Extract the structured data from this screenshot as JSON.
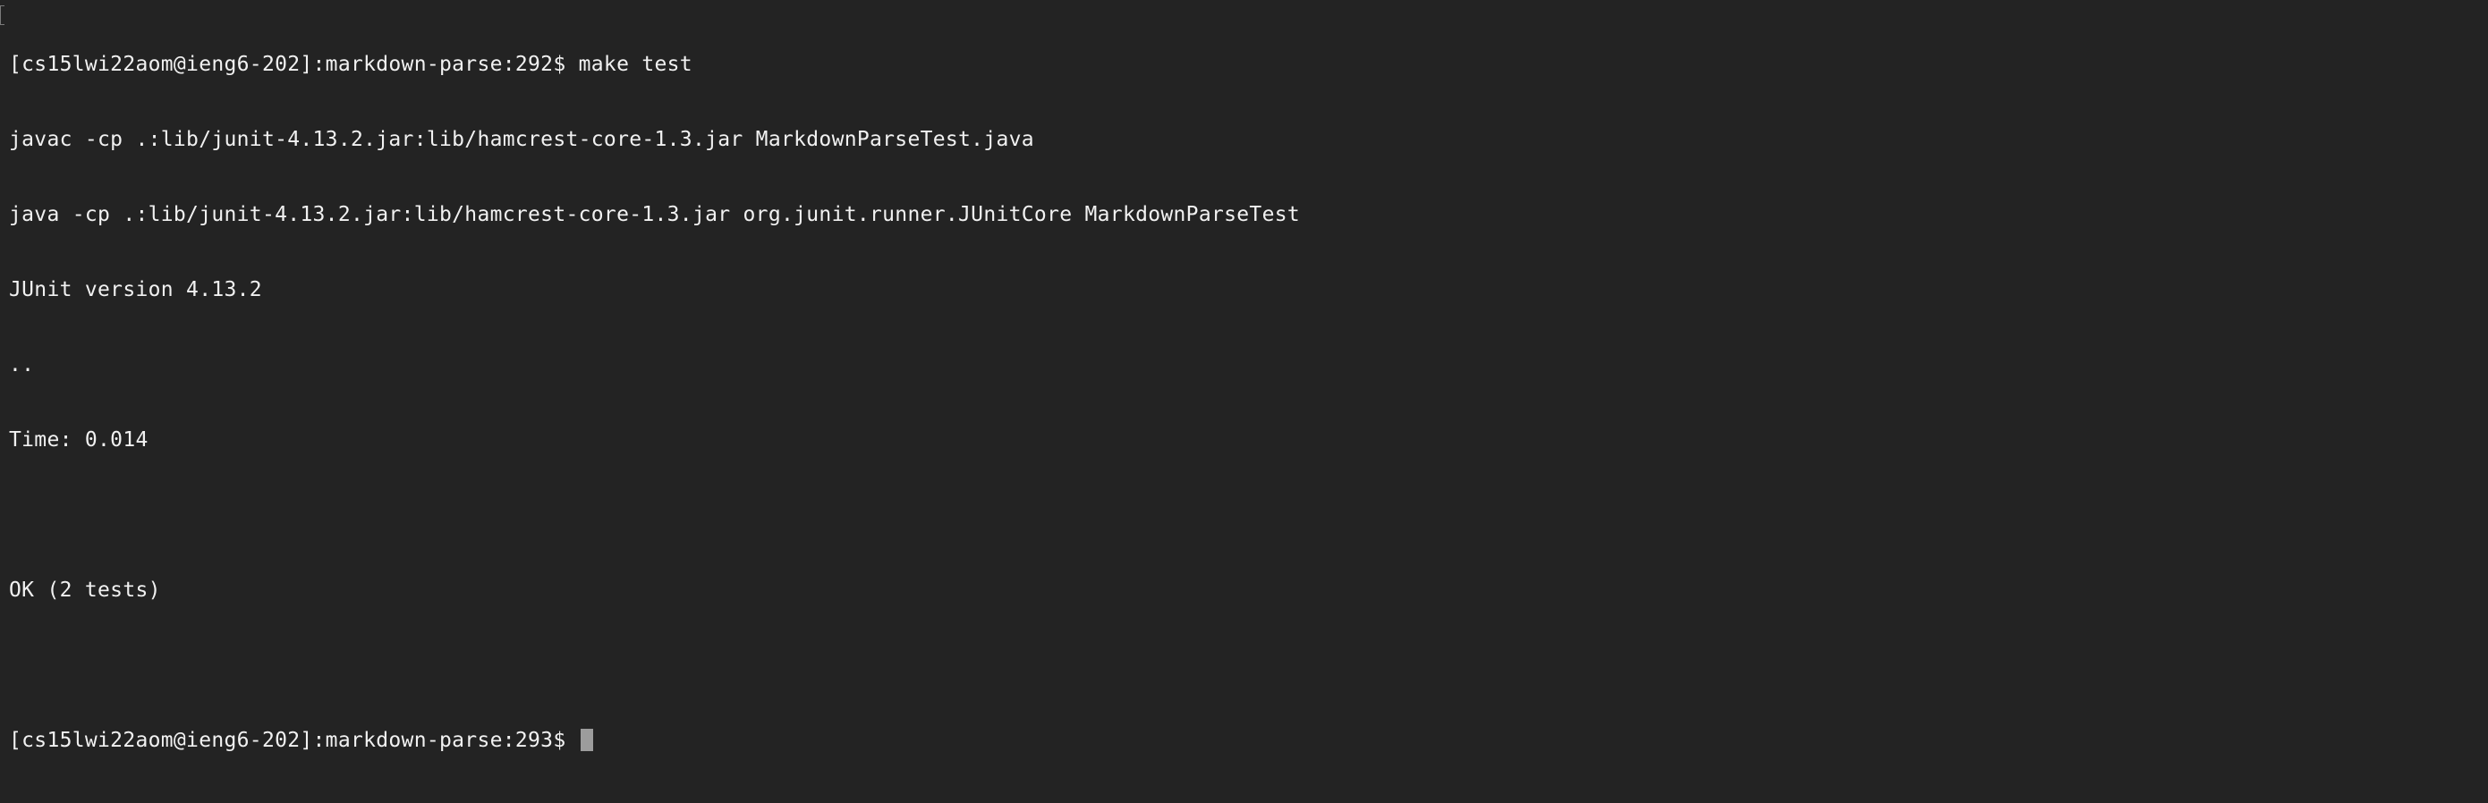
{
  "terminal": {
    "lines": [
      "[cs15lwi22aom@ieng6-202]:markdown-parse:292$ make test",
      "javac -cp .:lib/junit-4.13.2.jar:lib/hamcrest-core-1.3.jar MarkdownParseTest.java",
      "java -cp .:lib/junit-4.13.2.jar:lib/hamcrest-core-1.3.jar org.junit.runner.JUnitCore MarkdownParseTest",
      "JUnit version 4.13.2",
      "..",
      "Time: 0.014",
      "",
      "OK (2 tests)",
      "",
      "[cs15lwi22aom@ieng6-202]:markdown-parse:293$ "
    ]
  },
  "colors": {
    "background": "#232323",
    "text": "#f1f1f1",
    "cursor": "#9c9c9c"
  }
}
